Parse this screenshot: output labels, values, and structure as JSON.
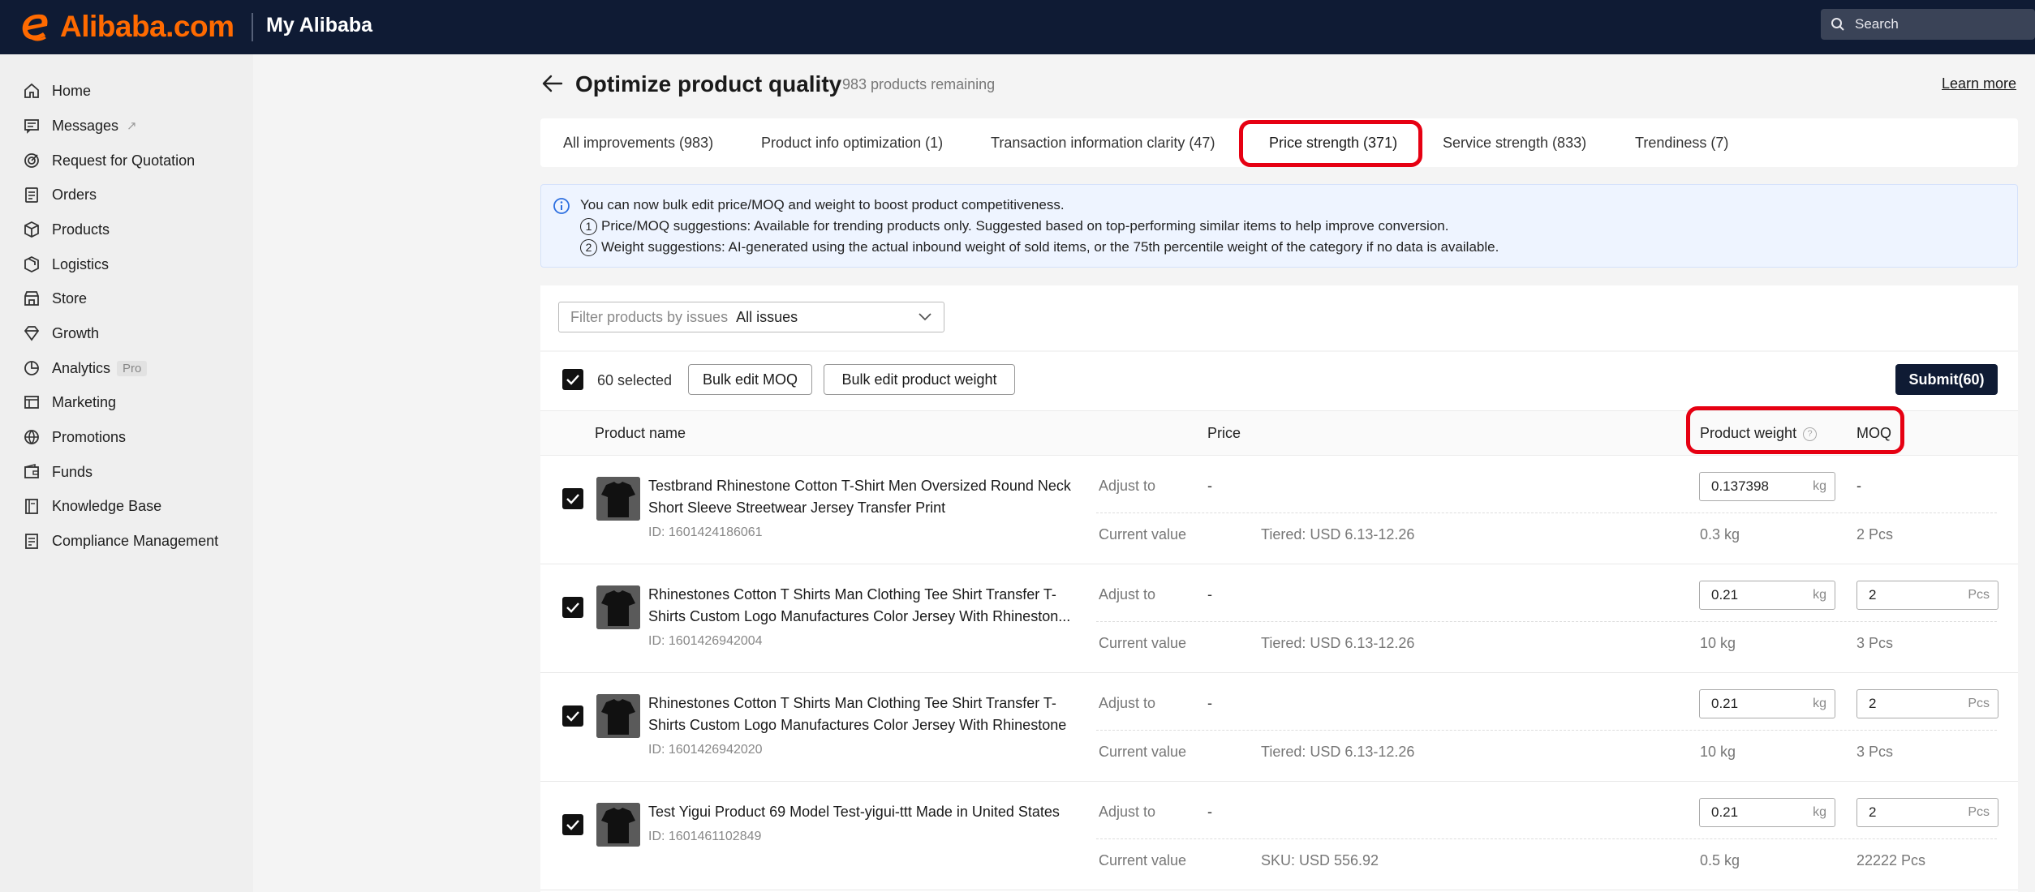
{
  "header": {
    "logo_text": "Alibaba.com",
    "app_title": "My Alibaba",
    "search_placeholder": "Search"
  },
  "sidebar": {
    "items": [
      {
        "label": "Home",
        "icon": "home-icon"
      },
      {
        "label": "Messages",
        "icon": "messages-icon",
        "external": "↗"
      },
      {
        "label": "Request for Quotation",
        "icon": "rfq-icon"
      },
      {
        "label": "Orders",
        "icon": "orders-icon"
      },
      {
        "label": "Products",
        "icon": "products-icon"
      },
      {
        "label": "Logistics",
        "icon": "logistics-icon"
      },
      {
        "label": "Store",
        "icon": "store-icon"
      },
      {
        "label": "Growth",
        "icon": "growth-icon"
      },
      {
        "label": "Analytics",
        "icon": "analytics-icon",
        "badge": "Pro"
      },
      {
        "label": "Marketing",
        "icon": "marketing-icon"
      },
      {
        "label": "Promotions",
        "icon": "promotions-icon"
      },
      {
        "label": "Funds",
        "icon": "funds-icon"
      },
      {
        "label": "Knowledge Base",
        "icon": "knowledge-icon"
      },
      {
        "label": "Compliance Management",
        "icon": "compliance-icon"
      }
    ]
  },
  "page": {
    "title": "Optimize product quality",
    "remaining": "983 products remaining",
    "learn_more": "Learn more"
  },
  "tabs": [
    {
      "label": "All improvements (983)"
    },
    {
      "label": "Product info optimization (1)"
    },
    {
      "label": "Transaction information clarity (47)"
    },
    {
      "label": "Price strength (371)",
      "active": true
    },
    {
      "label": "Service strength (833)"
    },
    {
      "label": "Trendiness (7)"
    }
  ],
  "notice": {
    "line1": "You can now bulk edit price/MOQ and weight to boost product competitiveness.",
    "n1": "1",
    "line2": "Price/MOQ suggestions: Available for trending products only. Suggested based on top-performing similar items to help improve conversion.",
    "n2": "2",
    "line3": "Weight suggestions: AI-generated using the actual inbound weight of sold items, or the 75th percentile weight of the category if no data is available."
  },
  "filter": {
    "label": "Filter products by issues",
    "value": "All issues"
  },
  "toolbar": {
    "selected": "60 selected",
    "bulk_moq": "Bulk edit MOQ",
    "bulk_weight": "Bulk edit product weight",
    "submit": "Submit(60)"
  },
  "table": {
    "col_product": "Product name",
    "col_price": "Price",
    "col_weight": "Product weight",
    "col_weight_help": "?",
    "col_moq": "MOQ",
    "label_adjust": "Adjust to",
    "label_current": "Current value",
    "unit_kg": "kg",
    "unit_pcs": "Pcs",
    "rows": [
      {
        "name": "Testbrand Rhinestone Cotton T-Shirt Men Oversized Round Neck Short Sleeve Streetwear Jersey Transfer Print",
        "id": "ID: 1601424186061",
        "price_adjust": "-",
        "price_current": "Tiered: USD 6.13-12.26",
        "weight_adjust": "0.137398",
        "weight_current": "0.3 kg",
        "moq_adjust": "-",
        "moq_current": "2 Pcs"
      },
      {
        "name": "Rhinestones Cotton T Shirts Man Clothing Tee Shirt Transfer T-Shirts Custom Logo Manufactures Color Jersey With Rhineston...",
        "id": "ID: 1601426942004",
        "price_adjust": "-",
        "price_current": "Tiered: USD 6.13-12.26",
        "weight_adjust": "0.21",
        "weight_current": "10 kg",
        "moq_adjust": "2",
        "moq_current": "3 Pcs"
      },
      {
        "name": "Rhinestones Cotton T Shirts Man Clothing Tee Shirt Transfer T-Shirts Custom Logo Manufactures Color Jersey With Rhinestone",
        "id": "ID: 1601426942020",
        "price_adjust": "-",
        "price_current": "Tiered: USD 6.13-12.26",
        "weight_adjust": "0.21",
        "weight_current": "10 kg",
        "moq_adjust": "2",
        "moq_current": "3 Pcs"
      },
      {
        "name": "Test Yigui Product 69 Model Test-yigui-ttt Made in United States",
        "id": "ID: 1601461102849",
        "price_adjust": "-",
        "price_current": "SKU: USD 556.92",
        "weight_adjust": "0.21",
        "weight_current": "0.5 kg",
        "moq_adjust": "2",
        "moq_current": "22222 Pcs"
      }
    ]
  },
  "colors": {
    "header_bg": "#0f1b34",
    "brand_orange": "#ff6a00",
    "highlight_red": "#e60012",
    "notice_bg": "#eef4ff"
  }
}
